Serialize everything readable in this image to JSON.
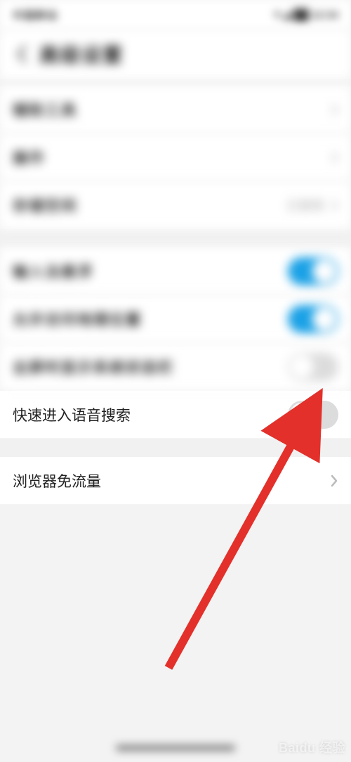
{
  "status_bar": {
    "left": "中国移动",
    "right": "▼◢ ██ 12:34"
  },
  "nav": {
    "title": "高级设置"
  },
  "blur_rows_1": [
    {
      "label": "辅助工具",
      "value": "",
      "chevron": true
    },
    {
      "label": "操作",
      "value": "",
      "chevron": true
    },
    {
      "label": "存储空间",
      "value": "已使用",
      "chevron": true
    }
  ],
  "blur_rows_2": [
    {
      "label": "输入法悬浮",
      "toggle": "on"
    },
    {
      "label": "允许访问地理位置",
      "toggle": "on"
    },
    {
      "label": "全屏时显示系统状态栏",
      "toggle": "off"
    }
  ],
  "voice_row": {
    "label": "快速进入语音搜索",
    "toggle": "off"
  },
  "traffic_row": {
    "label": "浏览器免流量"
  },
  "watermark": "Baidu 经验",
  "colors": {
    "accent": "#1aa1e6",
    "arrow": "#e3302a"
  }
}
